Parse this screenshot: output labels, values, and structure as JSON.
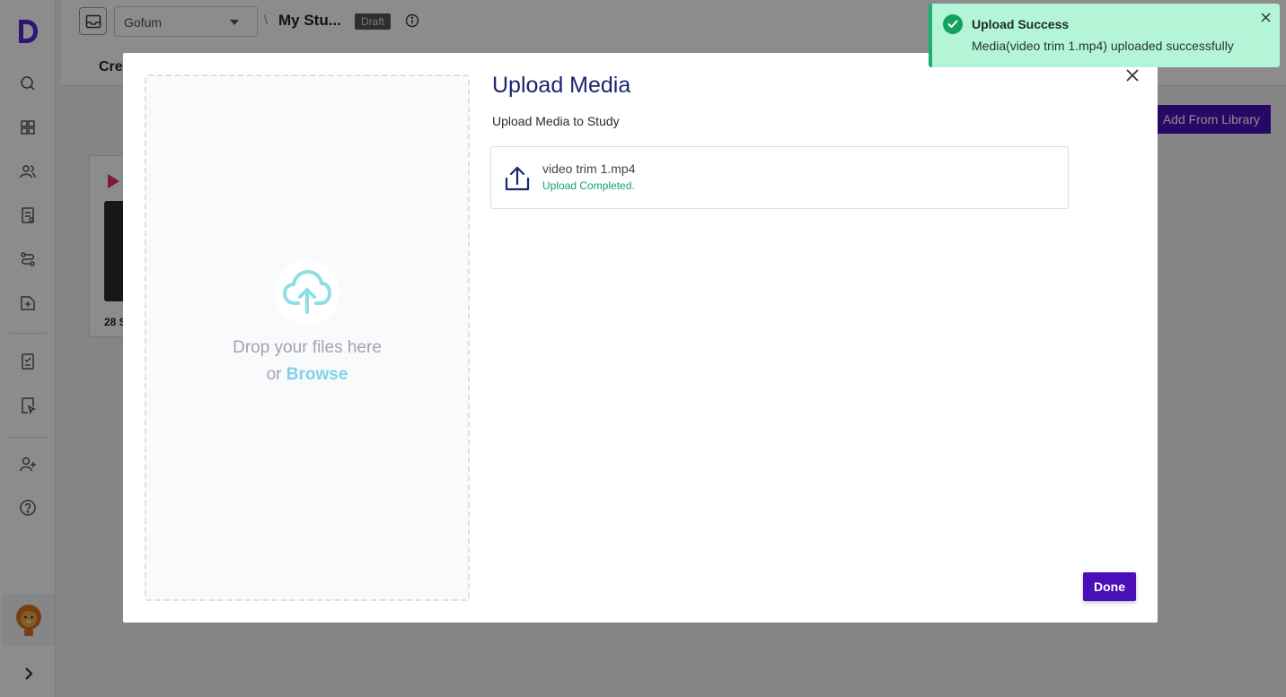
{
  "header": {
    "workspace": "Gofum",
    "separator": "\\",
    "study_title": "My Stu...",
    "status_badge": "Draft",
    "tab_label": "Cre"
  },
  "main": {
    "add_from_library_label": "Add From Library",
    "media_card_count": "28 S"
  },
  "modal": {
    "title": "Upload Media",
    "subtitle": "Upload Media to Study",
    "dropzone": {
      "line1": "Drop your files here",
      "or_text": "or",
      "browse_label": "Browse"
    },
    "files": [
      {
        "name": "video trim 1.mp4",
        "status": "Upload Completed."
      }
    ],
    "done_label": "Done"
  },
  "toast": {
    "title": "Upload Success",
    "message": "Media(video trim 1.mp4) uploaded successfully"
  },
  "colors": {
    "primary": "#4a0fb8",
    "title_blue": "#1a2570",
    "success_green": "#1aa16a",
    "toast_bg": "#b3f5d6",
    "browse_cyan": "#7ed3e6"
  },
  "icons": {
    "sidebar": [
      "search-icon",
      "dashboard-icon",
      "users-icon",
      "report-icon",
      "flow-icon",
      "add-file-icon",
      "checklist-icon",
      "review-icon",
      "add-user-icon",
      "help-icon"
    ]
  }
}
